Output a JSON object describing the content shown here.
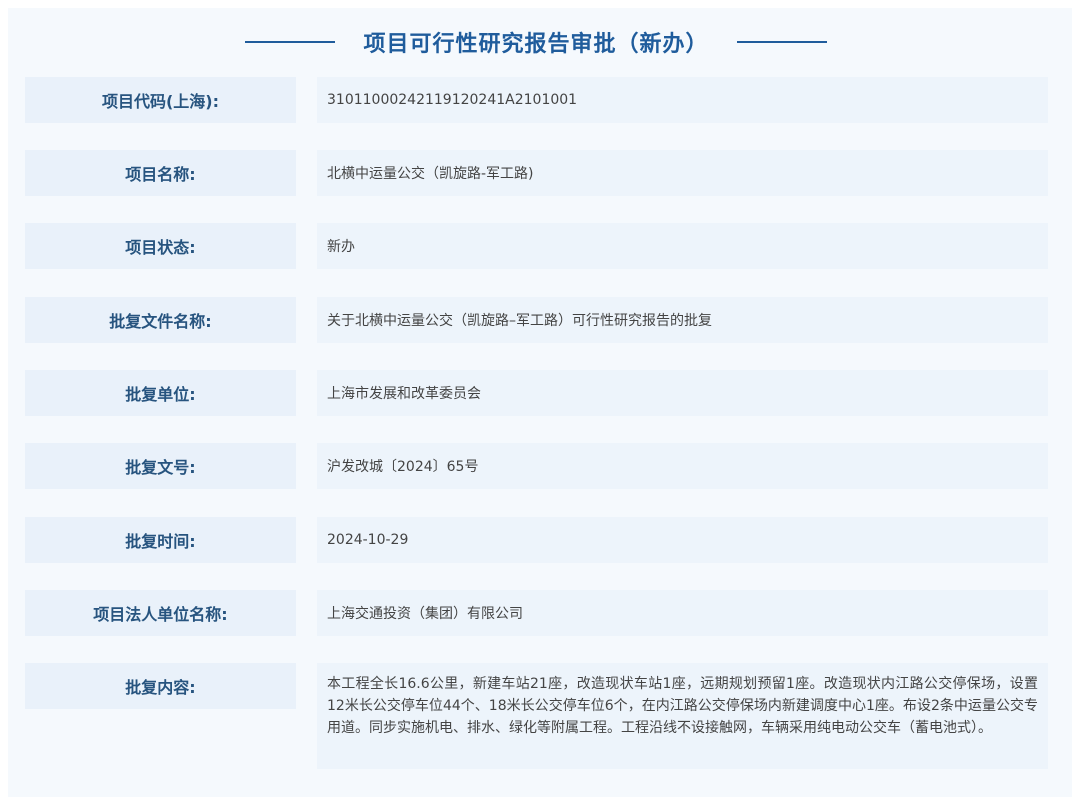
{
  "title": "项目可行性研究报告审批（新办）",
  "fields": [
    {
      "label": "项目代码(上海):",
      "value": "31011000242119120241A2101001"
    },
    {
      "label": "项目名称:",
      "value": "北横中运量公交（凯旋路-军工路)"
    },
    {
      "label": "项目状态:",
      "value": "新办"
    },
    {
      "label": "批复文件名称:",
      "value": "关于北横中运量公交（凯旋路–军工路）可行性研究报告的批复"
    },
    {
      "label": "批复单位:",
      "value": "上海市发展和改革委员会"
    },
    {
      "label": "批复文号:",
      "value": "沪发改城〔2024〕65号"
    },
    {
      "label": "批复时间:",
      "value": "2024-10-29"
    },
    {
      "label": "项目法人单位名称:",
      "value": "上海交通投资（集团）有限公司"
    },
    {
      "label": "批复内容:",
      "value": "本工程全长16.6公里，新建车站21座，改造现状车站1座，远期规划预留1座。改造现状内江路公交停保场，设置12米长公交停车位44个、18米长公交停车位6个，在内江路公交停保场内新建调度中心1座。布设2条中运量公交专用道。同步实施机电、排水、绿化等附属工程。工程沿线不设接触网，车辆采用纯电动公交车（蓄电池式）。"
    }
  ]
}
